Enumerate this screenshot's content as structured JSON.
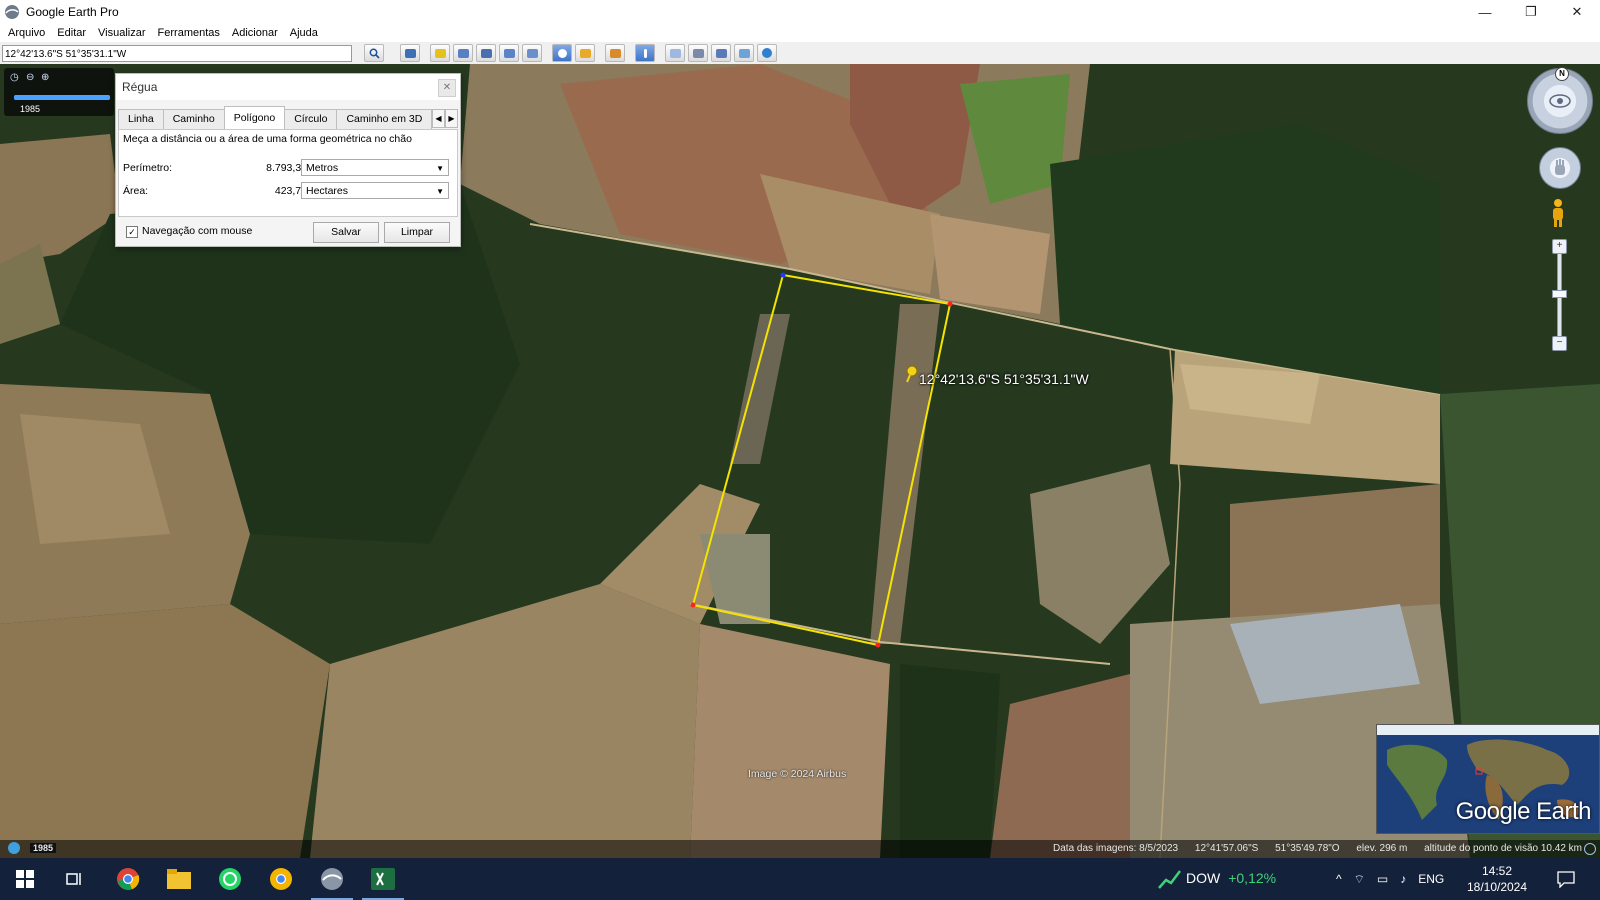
{
  "window": {
    "title": "Google Earth Pro",
    "controls": {
      "minimize": "—",
      "restore": "❐",
      "close": "✕"
    }
  },
  "menu": [
    "Arquivo",
    "Editar",
    "Visualizar",
    "Ferramentas",
    "Adicionar",
    "Ajuda"
  ],
  "search": {
    "value": "12°42'13.6\"S 51°35'31.1\"W"
  },
  "toolbar_icons": [
    "search-icon",
    "sidebar-icon",
    "placemark-icon",
    "polygon-icon",
    "path-icon",
    "image-overlay-icon",
    "tour-icon",
    "historical-imagery-icon",
    "sun-icon",
    "planets-icon",
    "ruler-icon",
    "email-icon",
    "print-icon",
    "save-image-icon",
    "maps-icon",
    "earth-icon"
  ],
  "time_slider": {
    "year": "1985",
    "position_fraction": 1.0
  },
  "ruler": {
    "title": "Régua",
    "tabs": [
      "Linha",
      "Caminho",
      "Polígono",
      "Círculo",
      "Caminho em 3D"
    ],
    "active_tab": "Polígono",
    "description": "Meça a distância ou a área de uma forma geométrica no chão",
    "perimeter_label": "Perímetro:",
    "perimeter_value": "8.793,32",
    "perimeter_unit": "Metros",
    "area_label": "Área:",
    "area_value": "423,70",
    "area_unit": "Hectares",
    "mouse_nav_label": "Navegação com mouse",
    "mouse_nav_checked": true,
    "save_label": "Salvar",
    "clear_label": "Limpar"
  },
  "navigation": {
    "north": "N",
    "zoom_in": "+",
    "zoom_out": "−"
  },
  "map": {
    "placemark_label": "12°42'13.6\"S 51°35'31.1\"W",
    "copyright": "Image © 2024 Airbus",
    "logo": "Google Earth",
    "polygon_color": "#f5e400"
  },
  "status": {
    "year": "1985",
    "imagery_date": "Data das imagens: 8/5/2023",
    "lat": "12°41'57.06\"S",
    "lon": "51°35'49.78\"O",
    "elev": "elev.  296 m",
    "eye_alt": "altitude do ponto de visão  10.42 km"
  },
  "taskbar": {
    "stock_name": "DOW",
    "stock_change": "+0,12%",
    "language": "ENG",
    "time": "14:52",
    "date": "18/10/2024"
  }
}
